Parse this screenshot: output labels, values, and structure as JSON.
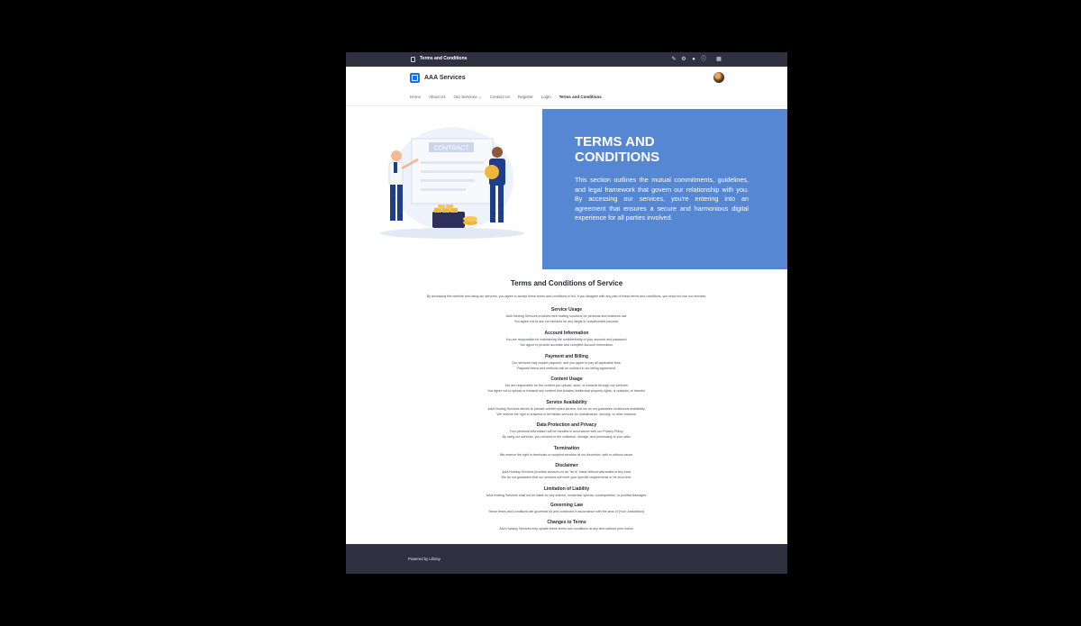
{
  "admin_bar": {
    "title": "Terms and Conditions",
    "icons": [
      "pencil-icon",
      "gear-icon",
      "circle-icon",
      "info-icon",
      "apps-grid-icon"
    ]
  },
  "site": {
    "name": "AAA Services",
    "nav": [
      {
        "label": "Home"
      },
      {
        "label": "About Us"
      },
      {
        "label": "Our Services"
      },
      {
        "label": "Contact Us"
      },
      {
        "label": "Register"
      },
      {
        "label": "Login"
      },
      {
        "label": "Terms and Conditions"
      }
    ]
  },
  "hero": {
    "title": "TERMS AND CONDITIONS",
    "text": "This section outlines the mutual commitments, guidelines, and legal framework that govern our relationship with you. By accessing our services, you're entering into an agreement that ensures a secure and harmonious digital experience for all parties involved.",
    "illustration_label": "CONTRACT"
  },
  "terms": {
    "title": "Terms and Conditions of Service",
    "intro": "By accessing this website and using our services, you agree to accept these terms and conditions in full. If you disagree with any part of these terms and conditions, you must not use our services.",
    "sections": [
      {
        "heading": "Service Usage",
        "lines": [
          "AAA Hosting Services provides web hosting solutions for personal and business use.",
          "You agree not to use our services for any illegal or unauthorized purpose."
        ]
      },
      {
        "heading": "Account Information",
        "lines": [
          "You are responsible for maintaining the confidentiality of your account and password.",
          "You agree to provide accurate and complete account information."
        ]
      },
      {
        "heading": "Payment and Billing",
        "lines": [
          "Our services may require payment, and you agree to pay all applicable fees.",
          "Payment terms and methods will be outlined in our billing agreement."
        ]
      },
      {
        "heading": "Content Usage",
        "lines": [
          "You are responsible for the content you upload, store, or transmit through our services.",
          "You agree not to upload or transmit any content that violates intellectual property rights, is unlawful, or harmful."
        ]
      },
      {
        "heading": "Service Availability",
        "lines": [
          "AAA Hosting Services strives to provide uninterrupted service, but we do not guarantee continuous availability.",
          "We reserve the right to suspend or terminate services for maintenance, security, or other reasons."
        ]
      },
      {
        "heading": "Data Protection and Privacy",
        "lines": [
          "Your personal information will be handled in accordance with our Privacy Policy.",
          "By using our services, you consent to the collection, storage, and processing of your data."
        ]
      },
      {
        "heading": "Termination",
        "lines": [
          "We reserve the right to terminate or suspend services at our discretion, with or without cause."
        ]
      },
      {
        "heading": "Disclaimer",
        "lines": [
          "AAA Hosting Services provides services on an \"as is\" basis without warranties of any kind.",
          "We do not guarantee that our services will meet your specific requirements or be error-free."
        ]
      },
      {
        "heading": "Limitation of Liability",
        "lines": [
          "AAA Hosting Services shall not be liable for any indirect, incidental, special, consequential, or punitive damages."
        ]
      },
      {
        "heading": "Governing Law",
        "lines": [
          "These terms and conditions are governed by and construed in accordance with the laws of [Your Jurisdiction]."
        ]
      },
      {
        "heading": "Changes to Terms",
        "lines": [
          "AAA Hosting Services may update these terms and conditions at any time without prior notice."
        ]
      }
    ]
  },
  "footer": {
    "text": "Powered by Liferay"
  },
  "colors": {
    "admin_bar": "#2f3140",
    "hero_panel": "#5687d2",
    "logo": "#1f6fd6",
    "footer": "#2f3140"
  }
}
